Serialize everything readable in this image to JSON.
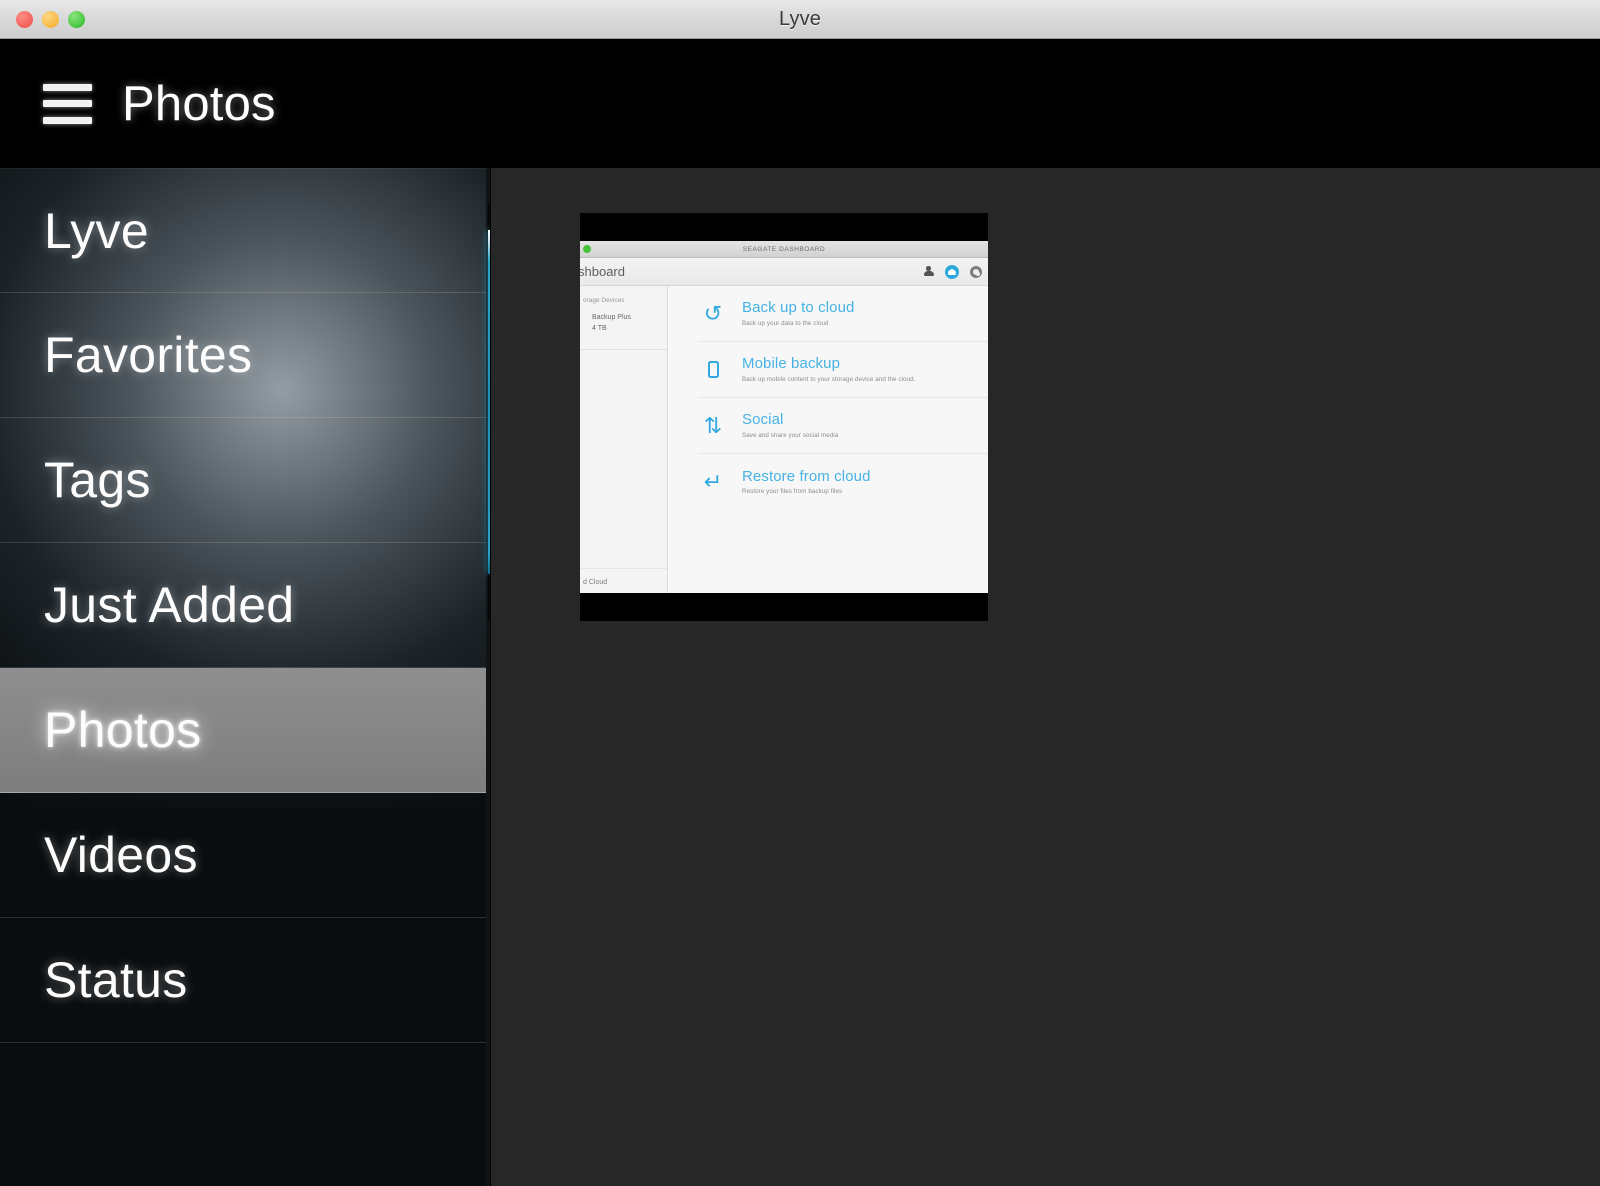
{
  "window": {
    "title": "Lyve",
    "traffic_lights": [
      "close",
      "minimize",
      "maximize"
    ]
  },
  "appbar": {
    "menu_icon": "hamburger-icon",
    "title": "Photos"
  },
  "sidebar": {
    "items": [
      {
        "label": "Lyve",
        "active": false
      },
      {
        "label": "Favorites",
        "active": false
      },
      {
        "label": "Tags",
        "active": false
      },
      {
        "label": "Just Added",
        "active": false
      },
      {
        "label": "Photos",
        "active": true
      },
      {
        "label": "Videos",
        "active": false
      },
      {
        "label": "Status",
        "active": false
      }
    ],
    "accent_color": "#2ba6c9",
    "active_background": "#868686"
  },
  "content": {
    "background": "#272727",
    "thumbnails": [
      {
        "name": "seagate-dashboard-screenshot",
        "window_title": "SEAGATE DASHBOARD",
        "toolbar_title": "shboard",
        "toolbar_icons": [
          "person-icon",
          "home-icon",
          "gear-icon"
        ],
        "side_header": "orage Devices",
        "device_name": "Backup Plus",
        "device_capacity": "4 TB",
        "side_footer": "d Cloud",
        "accent_color": "#47b2e4",
        "rows": [
          {
            "icon": "restore-arrow-icon",
            "glyph": "↺",
            "title": "Back up to cloud",
            "subtitle": "Back up your data to the cloud"
          },
          {
            "icon": "mobile-device-icon",
            "glyph": "",
            "title": "Mobile backup",
            "subtitle": "Back up mobile content to your storage device and the cloud."
          },
          {
            "icon": "social-sync-icon",
            "glyph": "⇅",
            "title": "Social",
            "subtitle": "Save and share your social media"
          },
          {
            "icon": "restore-from-cloud-icon",
            "glyph": "↵",
            "title": "Restore from cloud",
            "subtitle": "Restore your files from backup files"
          }
        ]
      }
    ]
  }
}
